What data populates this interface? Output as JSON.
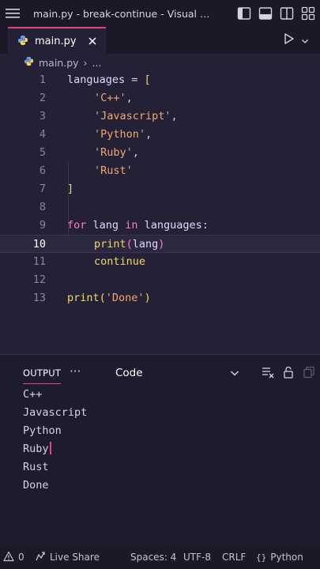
{
  "window": {
    "title": "main.py - break-continue - Visual Studi..."
  },
  "tab": {
    "label": "main.py"
  },
  "breadcrumb": {
    "file": "main.py",
    "more": "..."
  },
  "editor": {
    "line_numbers": [
      "1",
      "2",
      "3",
      "4",
      "5",
      "6",
      "7",
      "8",
      "9",
      "10",
      "11",
      "12",
      "13"
    ],
    "active_line": "10",
    "code": {
      "l1_var": "languages",
      "l1_eq": " = ",
      "l1_open": "[",
      "l2": "'C++'",
      "l3": "'Javascript'",
      "l4": "'Python'",
      "l5": "'Ruby'",
      "l6": "'Rust'",
      "comma": ",",
      "l7": "]",
      "l9_for": "for",
      "l9_lang": "lang",
      "l9_in": "in",
      "l9_langs": "languages",
      "l9_colon": ":",
      "l10_fn": "print",
      "l10_open": "(",
      "l10_arg": "lang",
      "l10_close": ")",
      "l11": "continue",
      "l13_fn": "print",
      "l13_open": "(",
      "l13_arg": "'Done'",
      "l13_close": ")"
    }
  },
  "panel": {
    "tab_label": "OUTPUT",
    "more": "···",
    "channel": "Code",
    "output_lines": [
      "C++",
      "Javascript",
      "Python",
      "Ruby",
      "Rust",
      "Done"
    ]
  },
  "status": {
    "problems": "0",
    "live_share": "Live Share",
    "spaces": "Spaces: 4",
    "encoding": "UTF-8",
    "eol": "CRLF",
    "language": "Python"
  },
  "colors": {
    "accent": "#e0457b",
    "keyword": "#ff7ac6",
    "function": "#f0d86a",
    "string": "#f2a86e",
    "background": "#242036"
  },
  "icons": [
    "menu-icon",
    "toggle-sidebar-icon",
    "toggle-panel-icon",
    "split-layout-icon",
    "customize-layout-icon",
    "python-file-icon",
    "close-icon",
    "run-icon",
    "chevron-down-icon",
    "clear-output-icon",
    "lock-icon",
    "copy-icon",
    "error-icon",
    "live-share-icon"
  ]
}
